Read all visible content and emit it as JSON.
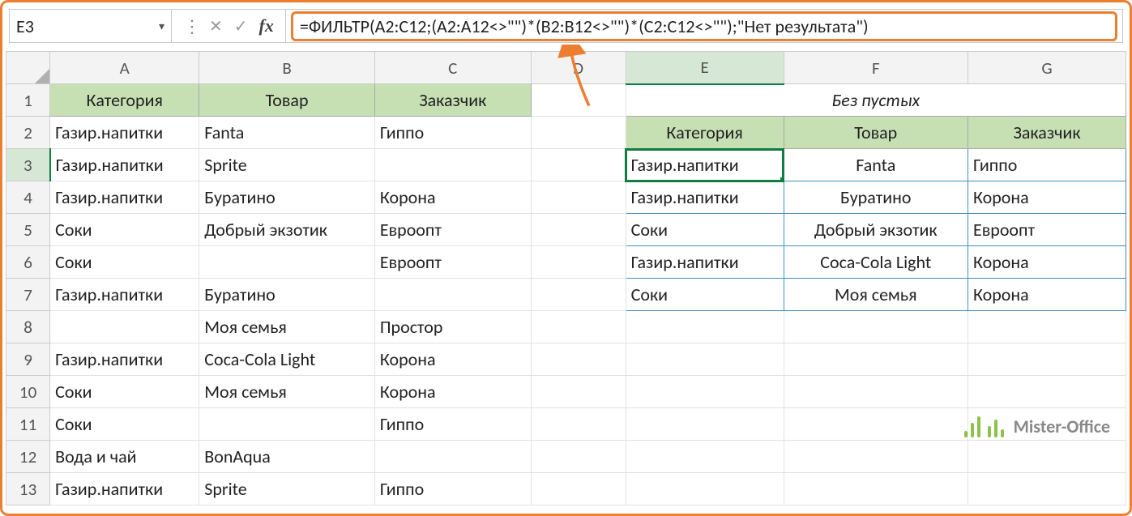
{
  "name_box": "E3",
  "formula": "=ФИЛЬТР(A2:C12;(A2:A12<>\"\")*(B2:B12<>\"\")*(C2:C12<>\"\");\"Нет результата\")",
  "cols": [
    "A",
    "B",
    "C",
    "D",
    "E",
    "F",
    "G"
  ],
  "rows": [
    "1",
    "2",
    "3",
    "4",
    "5",
    "6",
    "7",
    "8",
    "9",
    "10",
    "11",
    "12",
    "13"
  ],
  "table1": {
    "headers": [
      "Категория",
      "Товар",
      "Заказчик"
    ],
    "rows": [
      [
        "Газир.напитки",
        "Fanta",
        "Гиппо"
      ],
      [
        "Газир.напитки",
        "Sprite",
        ""
      ],
      [
        "Газир.напитки",
        "Буратино",
        "Корона"
      ],
      [
        "Соки",
        "Добрый экзотик",
        "Евроопт"
      ],
      [
        "Соки",
        "",
        "Евроопт"
      ],
      [
        "Газир.напитки",
        "Буратино",
        ""
      ],
      [
        "",
        "Моя семья",
        "Простор"
      ],
      [
        "Газир.напитки",
        "Coca-Cola Light",
        "Корона"
      ],
      [
        "Соки",
        "Моя семья",
        "Корона"
      ],
      [
        "Соки",
        "",
        "Гиппо"
      ],
      [
        "Вода и чай",
        "BonAqua",
        ""
      ],
      [
        "Газир.напитки",
        "Sprite",
        "Гиппо"
      ]
    ]
  },
  "table2": {
    "title": "Без пустых",
    "headers": [
      "Категория",
      "Товар",
      "Заказчик"
    ],
    "rows": [
      [
        "Газир.напитки",
        "Fanta",
        "Гиппо"
      ],
      [
        "Газир.напитки",
        "Буратино",
        "Корона"
      ],
      [
        "Соки",
        "Добрый экзотик",
        "Евроопт"
      ],
      [
        "Газир.напитки",
        "Coca-Cola Light",
        "Корона"
      ],
      [
        "Соки",
        "Моя семья",
        "Корона"
      ]
    ]
  },
  "watermark": "Mister-Office"
}
